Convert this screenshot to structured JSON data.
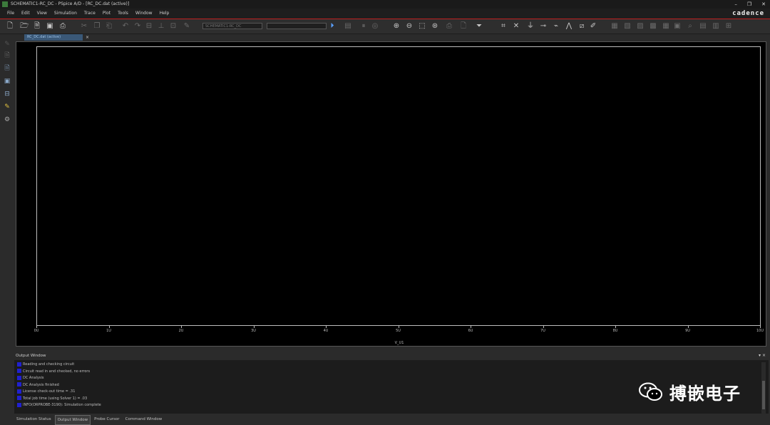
{
  "window": {
    "title": "SCHEMATIC1-RC_DC - PSpice A/D - [RC_DC.dat (active)]",
    "controls": [
      "–",
      "❐",
      "✕"
    ]
  },
  "menu": {
    "items": [
      "File",
      "Edit",
      "View",
      "Simulation",
      "Trace",
      "Plot",
      "Tools",
      "Window",
      "Help"
    ],
    "logo": "cadence"
  },
  "toolbar": {
    "profile_combo": "SCHEMATIC1-RC_DC",
    "trace_combo": ""
  },
  "document_tab": {
    "label": "RC_DC.dat (active)",
    "close": "×"
  },
  "plot": {
    "x_ticks": [
      "0U",
      "1U",
      "2U",
      "3U",
      "4U",
      "5U",
      "6U",
      "7U",
      "8U",
      "9U",
      "10U"
    ],
    "x_title": "V_U1"
  },
  "output_window": {
    "title": "Output Window",
    "controls": "▾ ×",
    "lines": [
      "Reading and checking circuit",
      "Circuit read in and checked, no errors",
      "DC Analysis",
      "DC Analysis finished",
      "License check-out time      =       .31",
      "Total job time (using Solver 1)     =       .03",
      "INFO(ORPROBE-3190): Simulation complete"
    ]
  },
  "bottom_tabs": [
    "Simulation Status",
    "Output Window",
    "Probe Cursor",
    "Command Window"
  ],
  "watermark": "搏嵌电子",
  "colors": {
    "accent_red": "#c02020",
    "tab_blue": "#3a5877"
  }
}
